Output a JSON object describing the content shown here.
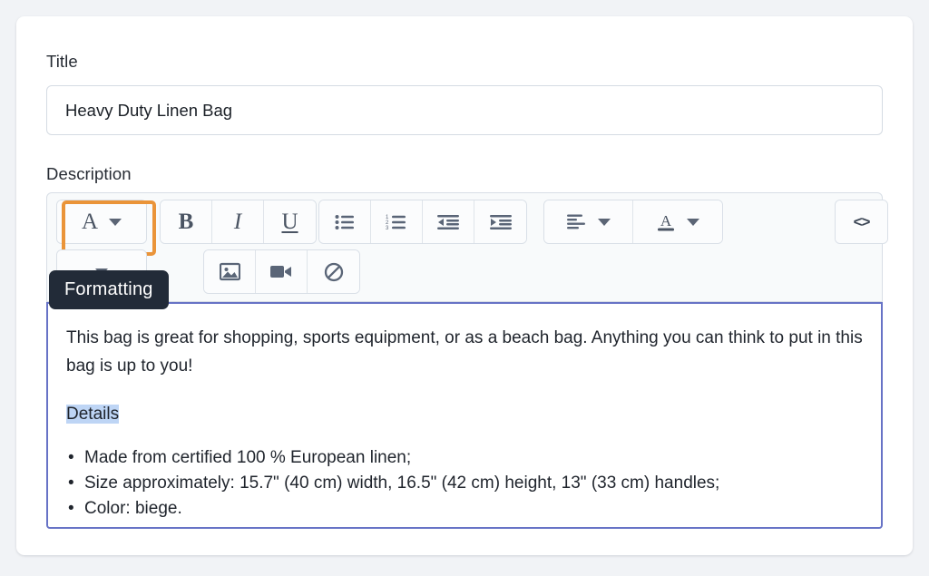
{
  "form": {
    "title_label": "Title",
    "title_value": "Heavy Duty Linen Bag",
    "title_placeholder": "Title",
    "description_label": "Description"
  },
  "toolbar": {
    "tooltip": "Formatting",
    "groups": [
      {
        "name": "formatting-group",
        "buttons": [
          {
            "name": "formatting-dropdown",
            "icon": "font-A-icon",
            "glyph": "A",
            "has_caret": true,
            "focused": true
          }
        ]
      },
      {
        "name": "style-group",
        "buttons": [
          {
            "name": "bold-button",
            "icon": "bold-icon",
            "glyph": "B"
          },
          {
            "name": "italic-button",
            "icon": "italic-icon",
            "glyph": "I"
          },
          {
            "name": "underline-button",
            "icon": "underline-icon",
            "glyph": "U"
          }
        ]
      },
      {
        "name": "list-group",
        "buttons": [
          {
            "name": "bulleted-list-button",
            "icon": "bulleted-list-icon"
          },
          {
            "name": "numbered-list-button",
            "icon": "numbered-list-icon"
          },
          {
            "name": "outdent-button",
            "icon": "outdent-icon"
          },
          {
            "name": "indent-button",
            "icon": "indent-icon"
          }
        ]
      },
      {
        "name": "alignment-color-group",
        "buttons": [
          {
            "name": "align-dropdown",
            "icon": "align-left-icon",
            "has_caret": true
          },
          {
            "name": "text-color-dropdown",
            "icon": "text-color-icon",
            "glyph": "A",
            "has_caret": true
          }
        ]
      },
      {
        "name": "code-group",
        "buttons": [
          {
            "name": "code-view-button",
            "icon": "code-brackets-icon",
            "glyph": "<>"
          }
        ]
      },
      {
        "name": "insert-dropdown-group",
        "buttons": [
          {
            "name": "insert-dropdown",
            "icon": "chevron-down-icon",
            "has_caret": true
          }
        ]
      },
      {
        "name": "media-group",
        "buttons": [
          {
            "name": "insert-image-button",
            "icon": "image-icon"
          },
          {
            "name": "insert-video-button",
            "icon": "video-camera-icon"
          },
          {
            "name": "clear-formatting-button",
            "icon": "prohibition-icon"
          }
        ]
      }
    ]
  },
  "editor": {
    "paragraph_1": "This bag is great for shopping, sports equipment, or as a beach bag. Anything you can think to put in this bag is up to you!",
    "paragraph_2_selected": "Details",
    "bullets": [
      "Made from certified 100 % European linen;",
      "Size approximately: 15.7\" (40 cm) width, 16.5\" (42 cm) height, 13\" (33 cm) handles;",
      "Color: biege."
    ]
  },
  "colors": {
    "page_background": "#f1f3f6",
    "card_background": "#ffffff",
    "focus_ring": "#ea9439",
    "editor_border": "#6773c6",
    "tooltip_background": "#222b38",
    "selection_highlight": "#bed5f5",
    "icon": "#5a6577"
  }
}
